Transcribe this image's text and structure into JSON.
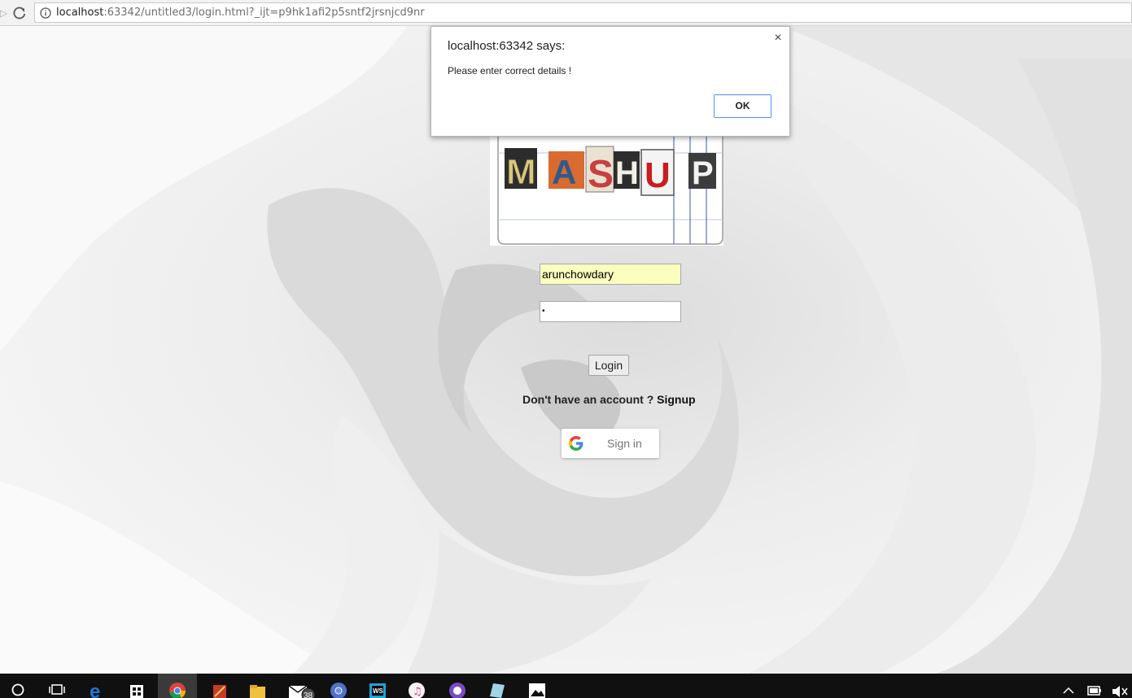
{
  "browser": {
    "url_host": "localhost",
    "url_rest": ":63342/untitled3/login.html?_ijt=p9hk1afi2p5sntf2jrsnjcd9nr"
  },
  "logo": {
    "letters": [
      "M",
      "A",
      "S",
      "H",
      "U",
      "P"
    ]
  },
  "login_form": {
    "username_value": "arunchowdary",
    "password_value": "•",
    "login_label": "Login",
    "no_account_text": "Don't have an account ? ",
    "signup_label": "Signup",
    "google_signin_label": "Sign in"
  },
  "alert": {
    "title": "localhost:63342 says:",
    "message": "Please enter correct details !",
    "ok_label": "OK",
    "close_glyph": "×"
  },
  "taskbar": {
    "items": [
      "cortana-icon",
      "task-view-icon",
      "edge-icon",
      "store-icon",
      "chrome-icon",
      "app-icon",
      "file-explorer-icon",
      "mail-icon",
      "chrome-canary-icon",
      "webstorm-icon",
      "itunes-icon",
      "app-purple-icon",
      "app-blue-icon",
      "photos-icon"
    ],
    "mail_badge": "38",
    "tray": [
      "chevron-up-icon",
      "battery-icon",
      "volume-muted-icon"
    ]
  }
}
